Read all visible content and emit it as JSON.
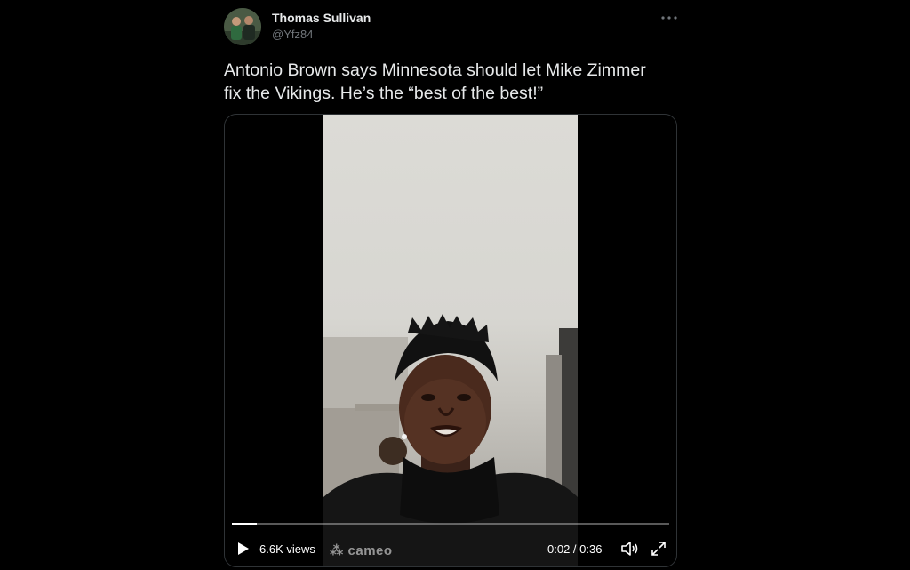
{
  "tweet": {
    "author_name": "Thomas Sullivan",
    "author_handle": "@Yfz84",
    "more_icon": "more-horizontal-icon",
    "text_line1": "Antonio Brown says Minnesota should let Mike Zimmer",
    "text_line2": "fix the Vikings.  He’s the “best of the best!”"
  },
  "video": {
    "views": "6.6K views",
    "watermark": "cameo",
    "time": "0:02 / 0:36",
    "progress": 0.056,
    "icons": [
      "play-icon",
      "volume-icon",
      "fullscreen-icon"
    ]
  },
  "colors": {
    "background": "#000000",
    "text": "#e7e9ea",
    "secondary_text": "#71767b",
    "border": "#2f3336"
  }
}
